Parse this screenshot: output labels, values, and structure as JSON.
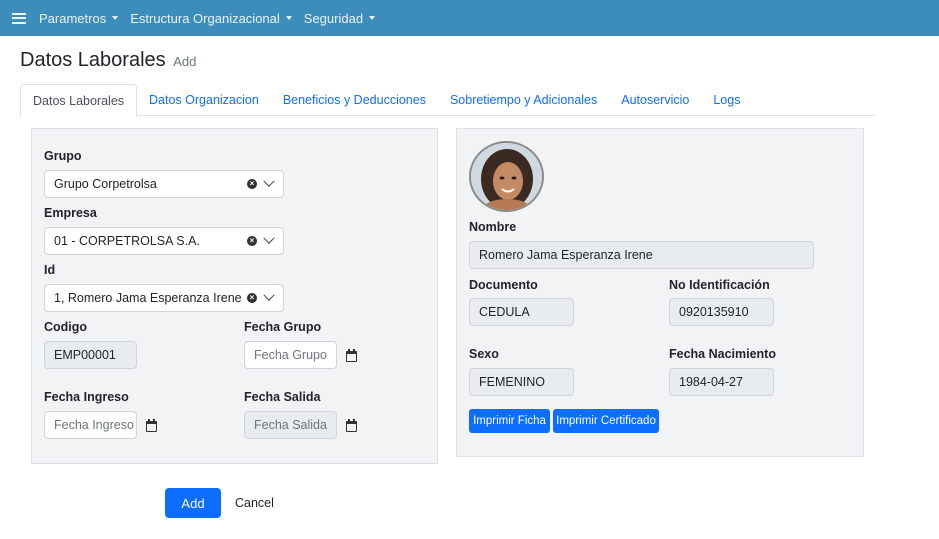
{
  "navbar": {
    "items": [
      {
        "label": "Parametros"
      },
      {
        "label": "Estructura Organizacional"
      },
      {
        "label": "Seguridad"
      }
    ]
  },
  "page": {
    "title": "Datos Laborales",
    "subtitle": "Add"
  },
  "tabs": [
    {
      "label": "Datos Laborales",
      "active": true
    },
    {
      "label": "Datos Organizacion"
    },
    {
      "label": "Beneficios y Deducciones"
    },
    {
      "label": "Sobretiempo y Adicionales"
    },
    {
      "label": "Autoservicio"
    },
    {
      "label": "Logs"
    }
  ],
  "form": {
    "grupo": {
      "label": "Grupo",
      "value": "Grupo Corpetrolsa"
    },
    "empresa": {
      "label": "Empresa",
      "value": "01 - CORPETROLSA S.A."
    },
    "id": {
      "label": "Id",
      "value": "1, Romero Jama Esperanza Irene"
    },
    "codigo": {
      "label": "Codigo",
      "value": "EMP00001"
    },
    "fecha_grupo": {
      "label": "Fecha Grupo",
      "placeholder": "Fecha Grupo"
    },
    "fecha_ingreso": {
      "label": "Fecha Ingreso",
      "placeholder": "Fecha Ingreso"
    },
    "fecha_salida": {
      "label": "Fecha Salida",
      "placeholder": "Fecha Salida"
    }
  },
  "employee": {
    "nombre": {
      "label": "Nombre",
      "value": "Romero Jama Esperanza Irene"
    },
    "documento": {
      "label": "Documento",
      "value": "CEDULA"
    },
    "no_identificacion": {
      "label": "No Identificación",
      "value": "0920135910"
    },
    "sexo": {
      "label": "Sexo",
      "value": "FEMENINO"
    },
    "fecha_nacimiento": {
      "label": "Fecha Nacimiento",
      "value": "1984-04-27"
    },
    "print_ficha_label": "Imprimir Ficha",
    "print_certificado_label": "Imprimir Certificado"
  },
  "actions": {
    "add_label": "Add",
    "cancel_label": "Cancel"
  },
  "colors": {
    "navbar": "#3c8dbc",
    "primary": "#0d6efd",
    "panel_bg": "#f1f3f5"
  }
}
